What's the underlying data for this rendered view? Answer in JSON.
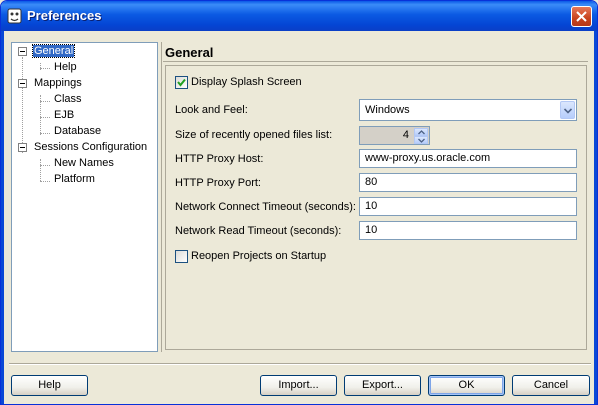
{
  "window": {
    "title": "Preferences"
  },
  "tree": {
    "items": [
      {
        "label": "General",
        "selected": true
      },
      {
        "label": "Help"
      },
      {
        "label": "Mappings"
      },
      {
        "label": "Class"
      },
      {
        "label": "EJB"
      },
      {
        "label": "Database"
      },
      {
        "label": "Sessions Configuration"
      },
      {
        "label": "New Names"
      },
      {
        "label": "Platform"
      }
    ]
  },
  "page": {
    "title": "General",
    "display_splash": {
      "label": "Display Splash Screen",
      "checked": true
    },
    "look_and_feel": {
      "label": "Look and Feel:",
      "value": "Windows"
    },
    "recent_files": {
      "label": "Size of recently opened files list:",
      "value": "4"
    },
    "proxy_host": {
      "label": "HTTP Proxy Host:",
      "value": "www-proxy.us.oracle.com"
    },
    "proxy_port": {
      "label": "HTTP Proxy Port:",
      "value": "80"
    },
    "connect_timeout": {
      "label": "Network Connect Timeout (seconds):",
      "value": "10"
    },
    "read_timeout": {
      "label": "Network Read Timeout (seconds):",
      "value": "10"
    },
    "reopen_projects": {
      "label": "Reopen Projects on Startup",
      "checked": false
    }
  },
  "buttons": {
    "help": "Help",
    "import": "Import...",
    "export": "Export...",
    "ok": "OK",
    "cancel": "Cancel"
  },
  "colors": {
    "title_bar": "#0a58e6",
    "selection": "#3169c6",
    "close": "#c8431d"
  }
}
